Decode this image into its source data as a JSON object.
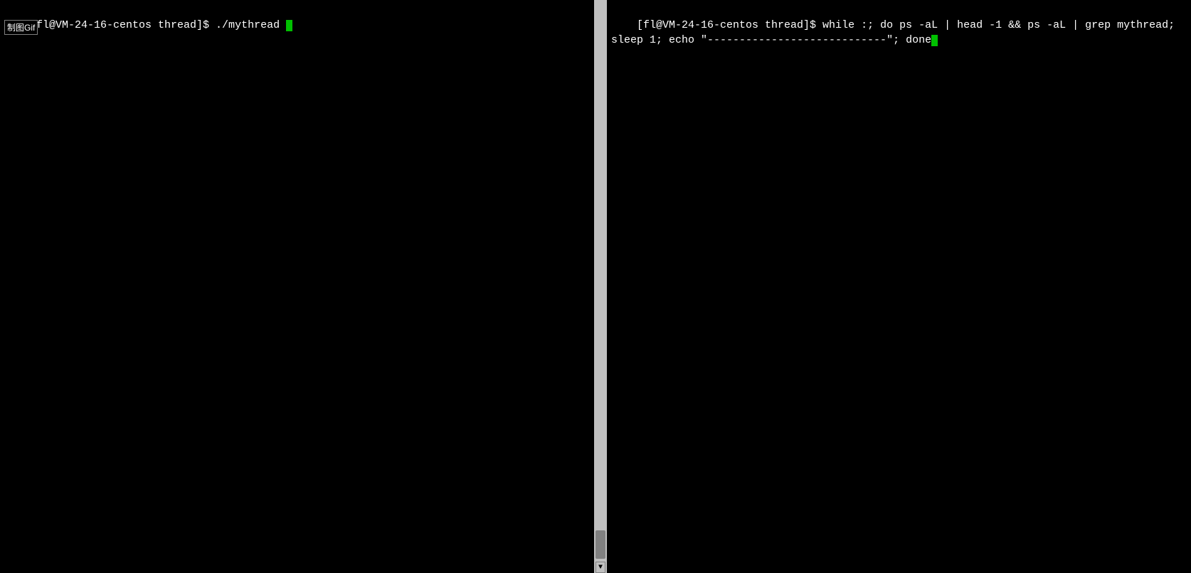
{
  "left_pane": {
    "prompt_line": "[fl@VM-24-16-centos thread]$ ./mythread ",
    "gif_badge": "制图Gif"
  },
  "right_pane": {
    "prompt_line": "[fl@VM-24-16-centos thread]$ while :; do ps -aL | head -1 && ps -aL | grep mythread; sleep 1; echo \"----------------------------\"; done"
  },
  "scrollbar": {
    "arrow_down": "▼"
  }
}
